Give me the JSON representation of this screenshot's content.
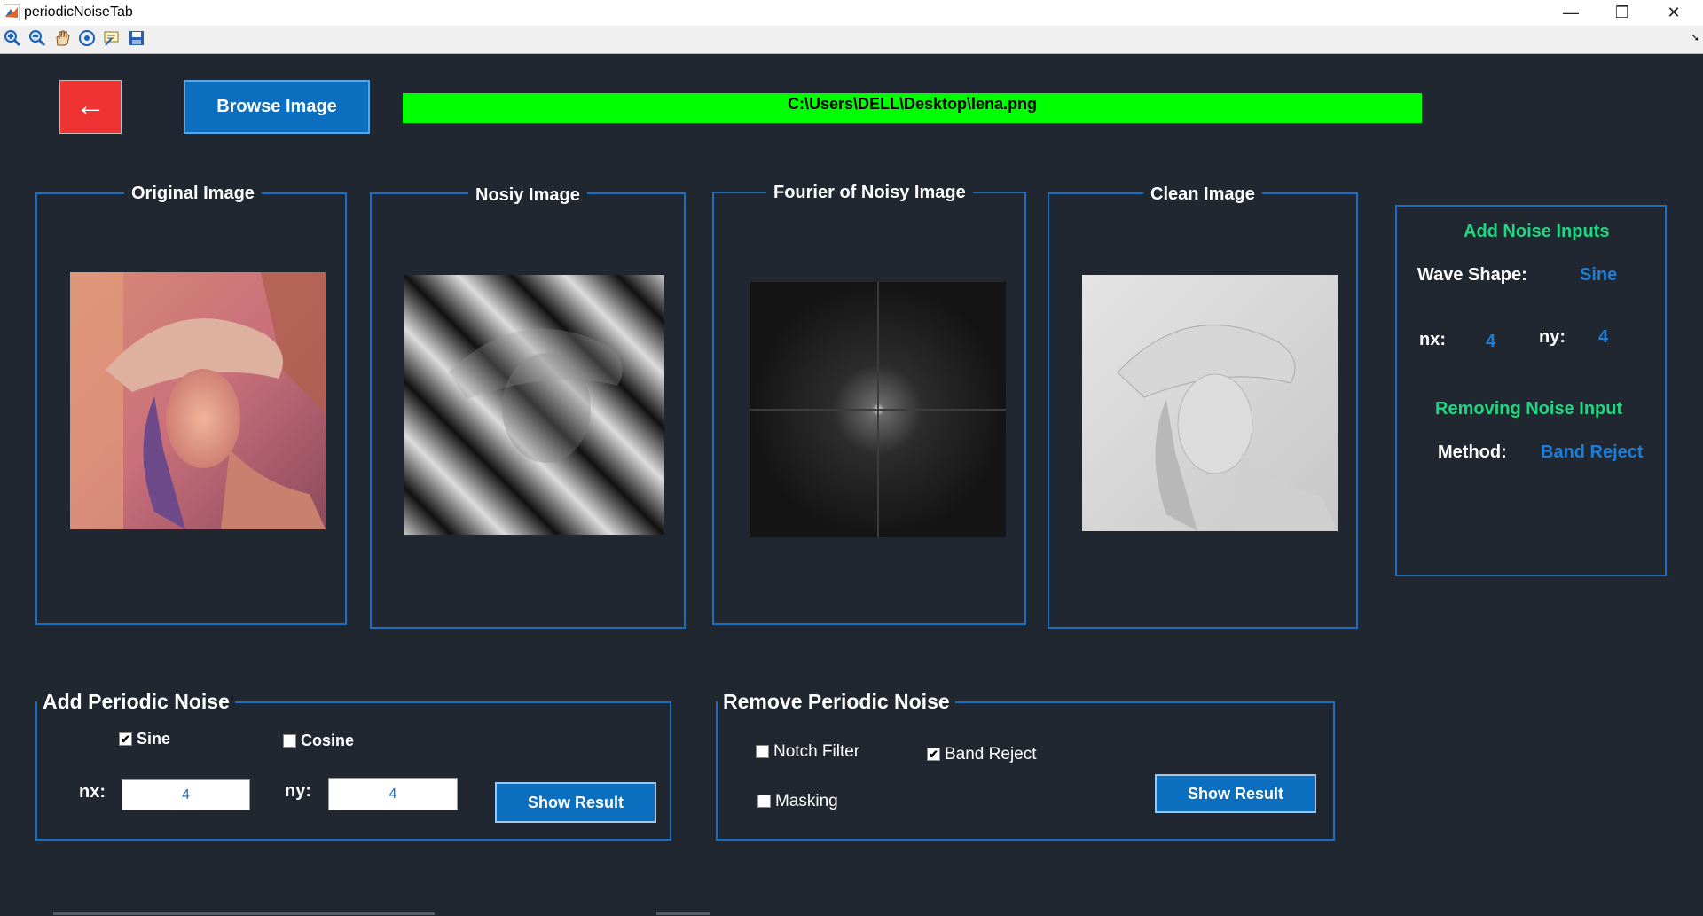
{
  "window": {
    "title": "periodicNoiseTab",
    "minimize_glyph": "—",
    "restore_glyph": "❐",
    "close_glyph": "✕"
  },
  "toolbar": {
    "icons": [
      "zoom-in-icon",
      "zoom-out-icon",
      "pan-hand-icon",
      "rotate-3d-icon",
      "data-cursor-icon",
      "save-icon"
    ],
    "expand_glyph": "➘"
  },
  "header": {
    "back_glyph": "←",
    "browse_label": "Browse Image",
    "file_path": "C:\\Users\\DELL\\Desktop\\lena.png"
  },
  "panels": {
    "original": "Original Image",
    "noisy": "Nosiy Image",
    "fourier": "Fourier of Noisy Image",
    "clean": "Clean Image"
  },
  "info": {
    "add_noise_heading": "Add Noise Inputs",
    "wave_shape_label": "Wave Shape:",
    "wave_shape_value": "Sine",
    "nx_label": "nx:",
    "nx_value": "4",
    "ny_label": "ny:",
    "ny_value": "4",
    "remove_heading": "Removing Noise Input",
    "method_label": "Method:",
    "method_value": "Band Reject"
  },
  "add_noise": {
    "title": "Add Periodic Noise",
    "sine_label": "Sine",
    "sine_checked": true,
    "cosine_label": "Cosine",
    "cosine_checked": false,
    "nx_label": "nx:",
    "nx_value": "4",
    "ny_label": "ny:",
    "ny_value": "4",
    "show_result_label": "Show Result"
  },
  "remove_noise": {
    "title": "Remove Periodic Noise",
    "notch_label": "Notch Filter",
    "notch_checked": false,
    "band_label": "Band Reject",
    "band_checked": true,
    "masking_label": "Masking",
    "masking_checked": false,
    "show_result_label": "Show Result"
  },
  "colors": {
    "background": "#212730",
    "accent_blue": "#0c6ebf",
    "frame_border": "#1c6fc0",
    "path_bar": "#00ff00",
    "back_button": "#ef3232",
    "info_heading": "#1fd682",
    "info_value": "#1c7ed6"
  }
}
